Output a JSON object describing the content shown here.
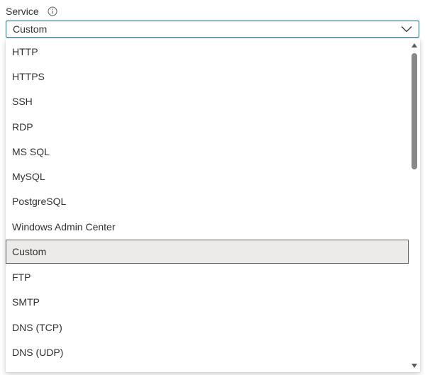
{
  "field": {
    "label": "Service",
    "info_icon": "info-circle-icon"
  },
  "select": {
    "value": "Custom",
    "chevron_icon": "chevron-down-icon"
  },
  "options": [
    {
      "label": "HTTP"
    },
    {
      "label": "HTTPS"
    },
    {
      "label": "SSH"
    },
    {
      "label": "RDP"
    },
    {
      "label": "MS SQL"
    },
    {
      "label": "MySQL"
    },
    {
      "label": "PostgreSQL"
    },
    {
      "label": "Windows Admin Center"
    },
    {
      "label": "Custom",
      "selected": true
    },
    {
      "label": "FTP"
    },
    {
      "label": "SMTP"
    },
    {
      "label": "DNS (TCP)"
    },
    {
      "label": "DNS (UDP)"
    }
  ],
  "scrollbar": {
    "up_icon": "scroll-up-arrow-icon",
    "down_icon": "scroll-down-arrow-icon",
    "position_fraction": 0.0
  },
  "colors": {
    "focus_border": "#0f6b8a",
    "selected_bg": "#edebe9",
    "text": "#323130",
    "scroll_thumb": "#8a8886"
  }
}
